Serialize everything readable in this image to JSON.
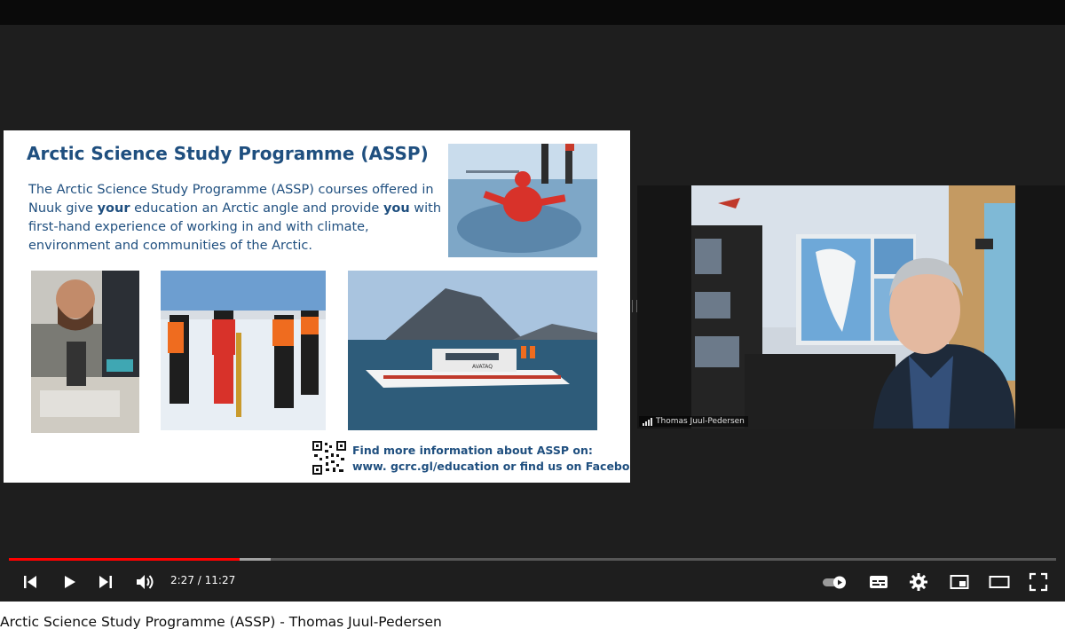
{
  "slide": {
    "title": "Arctic Science Study Programme (ASSP)",
    "body_1": "The Arctic Science Study Programme (ASSP) courses offered in Nuuk give ",
    "body_bold_1": "your",
    "body_2": " education an Arctic angle and provide ",
    "body_bold_2": "you",
    "body_3": " with first-hand experience of working in and with climate, environment and communities of the Arctic.",
    "info_line_1": "Find more information about ASSP on:",
    "info_line_2": "www. gcrc.gl/education or find us on Facebook",
    "boat_label": "AVATAQ"
  },
  "webcam": {
    "participant_name": "Thomas Juul-Pedersen"
  },
  "player": {
    "current_time": "2:27",
    "separator": " / ",
    "duration": "11:27",
    "played_fraction": 0.22,
    "buffered_fraction": 0.25,
    "accent_color": "#ff0000"
  },
  "video": {
    "title": "Arctic Science Study Programme (ASSP) - Thomas Juul-Pedersen"
  },
  "icons": [
    "skip-previous-icon",
    "play-icon",
    "skip-next-icon",
    "volume-icon",
    "autoplay-toggle-icon",
    "subtitles-icon",
    "settings-icon",
    "miniplayer-icon",
    "theater-mode-icon",
    "fullscreen-icon"
  ]
}
